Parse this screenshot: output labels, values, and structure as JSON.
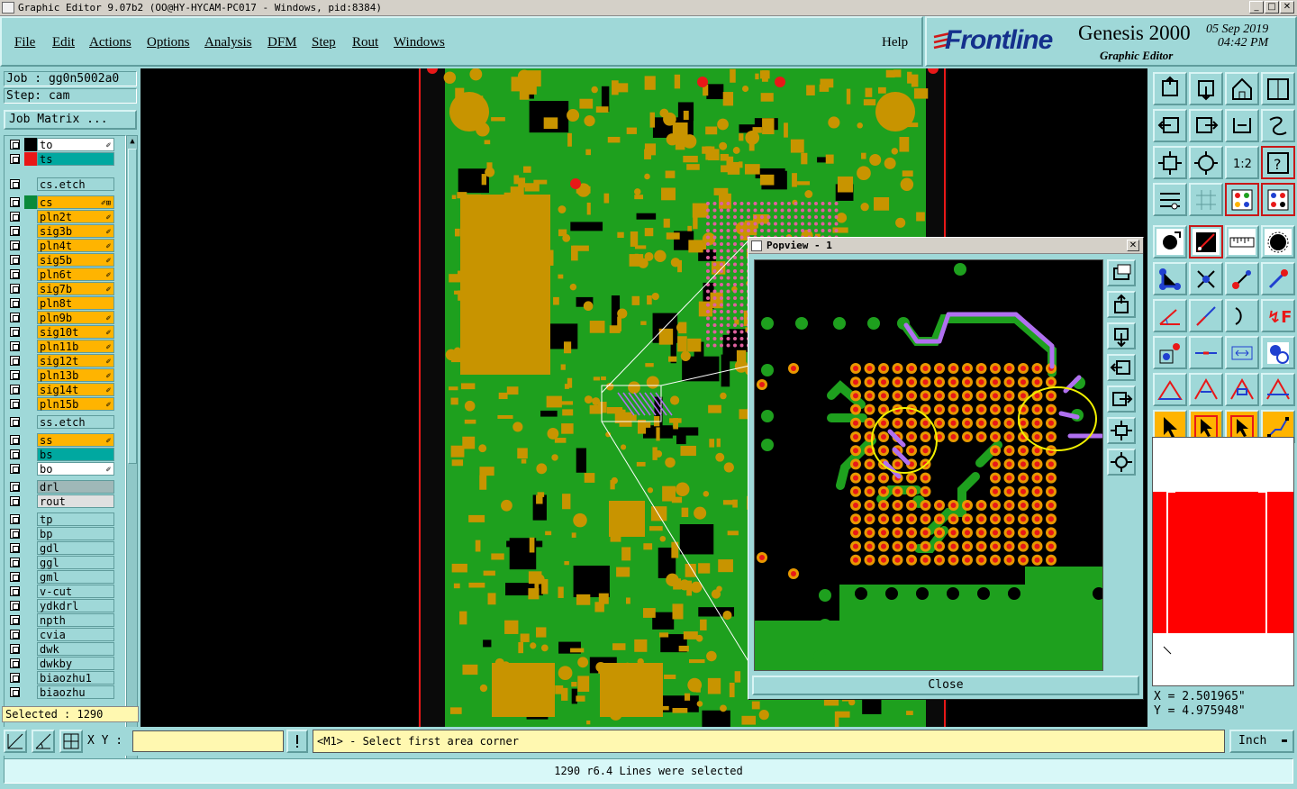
{
  "window": {
    "title": "Graphic Editor 9.07b2 (OO@HY-HYCAM-PC017 - Windows, pid:8384)"
  },
  "menu": {
    "items": [
      "File",
      "Edit",
      "Actions",
      "Options",
      "Analysis",
      "DFM",
      "Step",
      "Rout",
      "Windows"
    ],
    "help": "Help"
  },
  "brand": {
    "logo": "Frontline",
    "product": "Genesis 2000",
    "subtitle": "Graphic Editor",
    "date": "05 Sep 2019",
    "time": "04:42 PM"
  },
  "job": {
    "job_line": "Job : gg0n5002a0",
    "step_line": "Step: cam",
    "matrix_button": "Job Matrix ..."
  },
  "layers": [
    {
      "name": "to",
      "color": "#ffffff",
      "swatch": "#000000",
      "mark": "✐"
    },
    {
      "name": "ts",
      "color": "#00a8a0",
      "swatch": "#e81818",
      "mark": ""
    },
    {
      "name": "cs.etch",
      "color": "#9fd8d8",
      "swatch": "#9fd8d8",
      "mark": ""
    },
    {
      "name": "cs",
      "color": "#ffb400",
      "swatch": "#0a8a3a",
      "mark": "✐⊞"
    },
    {
      "name": "pln2t",
      "color": "#ffb400",
      "swatch": "#9fd8d8",
      "mark": "✐"
    },
    {
      "name": "sig3b",
      "color": "#ffb400",
      "swatch": "#9fd8d8",
      "mark": "✐"
    },
    {
      "name": "pln4t",
      "color": "#ffb400",
      "swatch": "#9fd8d8",
      "mark": "✐"
    },
    {
      "name": "sig5b",
      "color": "#ffb400",
      "swatch": "#9fd8d8",
      "mark": "✐"
    },
    {
      "name": "pln6t",
      "color": "#ffb400",
      "swatch": "#9fd8d8",
      "mark": "✐"
    },
    {
      "name": "sig7b",
      "color": "#ffb400",
      "swatch": "#9fd8d8",
      "mark": "✐"
    },
    {
      "name": "pln8t",
      "color": "#ffb400",
      "swatch": "#9fd8d8",
      "mark": ""
    },
    {
      "name": "pln9b",
      "color": "#ffb400",
      "swatch": "#9fd8d8",
      "mark": "✐"
    },
    {
      "name": "sig10t",
      "color": "#ffb400",
      "swatch": "#9fd8d8",
      "mark": "✐"
    },
    {
      "name": "pln11b",
      "color": "#ffb400",
      "swatch": "#9fd8d8",
      "mark": "✐"
    },
    {
      "name": "sig12t",
      "color": "#ffb400",
      "swatch": "#9fd8d8",
      "mark": "✐"
    },
    {
      "name": "pln13b",
      "color": "#ffb400",
      "swatch": "#9fd8d8",
      "mark": "✐"
    },
    {
      "name": "sig14t",
      "color": "#ffb400",
      "swatch": "#9fd8d8",
      "mark": "✐"
    },
    {
      "name": "pln15b",
      "color": "#ffb400",
      "swatch": "#9fd8d8",
      "mark": "✐"
    },
    {
      "name": "ss.etch",
      "color": "#9fd8d8",
      "swatch": "#9fd8d8",
      "mark": ""
    },
    {
      "name": "ss",
      "color": "#ffb400",
      "swatch": "#9fd8d8",
      "mark": "✐"
    },
    {
      "name": "bs",
      "color": "#00a8a0",
      "swatch": "#9fd8d8",
      "mark": ""
    },
    {
      "name": "bo",
      "color": "#ffffff",
      "swatch": "#9fd8d8",
      "mark": "✐"
    },
    {
      "name": "drl",
      "color": "#9fb8b8",
      "swatch": "#9fd8d8",
      "mark": ""
    },
    {
      "name": "rout",
      "color": "#e0e0e0",
      "swatch": "#9fd8d8",
      "mark": ""
    },
    {
      "name": "tp",
      "color": "#9fd8d8",
      "swatch": "#9fd8d8",
      "mark": ""
    },
    {
      "name": "bp",
      "color": "#9fd8d8",
      "swatch": "#9fd8d8",
      "mark": ""
    },
    {
      "name": "gdl",
      "color": "#9fd8d8",
      "swatch": "#9fd8d8",
      "mark": ""
    },
    {
      "name": "ggl",
      "color": "#9fd8d8",
      "swatch": "#9fd8d8",
      "mark": ""
    },
    {
      "name": "gml",
      "color": "#9fd8d8",
      "swatch": "#9fd8d8",
      "mark": ""
    },
    {
      "name": "v-cut",
      "color": "#9fd8d8",
      "swatch": "#9fd8d8",
      "mark": ""
    },
    {
      "name": "ydkdrl",
      "color": "#9fd8d8",
      "swatch": "#9fd8d8",
      "mark": ""
    },
    {
      "name": "npth",
      "color": "#9fd8d8",
      "swatch": "#9fd8d8",
      "mark": ""
    },
    {
      "name": "cvia",
      "color": "#9fd8d8",
      "swatch": "#9fd8d8",
      "mark": ""
    },
    {
      "name": "dwk",
      "color": "#9fd8d8",
      "swatch": "#9fd8d8",
      "mark": ""
    },
    {
      "name": "dwkby",
      "color": "#9fd8d8",
      "swatch": "#9fd8d8",
      "mark": ""
    },
    {
      "name": "biaozhu1",
      "color": "#9fd8d8",
      "swatch": "#9fd8d8",
      "mark": ""
    },
    {
      "name": "biaozhu",
      "color": "#9fd8d8",
      "swatch": "#9fd8d8",
      "mark": ""
    }
  ],
  "selection": {
    "selected_text": "Selected : 1290"
  },
  "popview": {
    "title": "Popview - 1",
    "close_label": "Close",
    "tools": [
      "zoom-home-icon",
      "pan-up-icon",
      "pan-down-icon",
      "pan-left-icon",
      "pan-right-icon",
      "zoom-fit-icon",
      "zoom-center-icon"
    ]
  },
  "tools": [
    [
      "zoom-home-icon",
      "pan-down-icon",
      "house-icon",
      "window-split-icon"
    ],
    [
      "pan-left-icon",
      "pan-right-icon",
      "undo-view-icon",
      "redo-view-icon"
    ],
    [
      "fit-all-icon",
      "zoom-center-icon",
      "scale-1-2-icon",
      "help-icon"
    ],
    [
      "layers-settings-icon",
      "grid-icon",
      "palette-icon",
      "palette-alt-icon"
    ],
    [
      "select-pad-icon",
      "measure-icon",
      "ruler-icon",
      "snap-point-icon"
    ],
    [
      "net-icon",
      "cross-icon",
      "add-segment-icon",
      "move-segment-icon"
    ],
    [
      "line-angle-icon",
      "line-icon",
      "arc-icon",
      "text-feature-icon"
    ],
    [
      "pad-icon",
      "line-horizontal-icon",
      "dimension-icon",
      "pattern-icon"
    ],
    [
      "triangle-icon",
      "triangle-a-icon",
      "triangle-b-icon",
      "triangle-c-icon"
    ],
    [
      "pointer-icon",
      "pointer-alt-icon",
      "pointer-target-icon",
      "route-icon"
    ]
  ],
  "colors": {
    "panel_bg": "#9fd8d8",
    "copper": "#1ea01e",
    "pad": "#c89400",
    "red_pad": "#e81818",
    "selected_line": "#b070f0",
    "highlight": "#f0f000"
  },
  "coords": {
    "x_line": "X = 2.501965\"",
    "y_line": "Y = 4.975948\""
  },
  "command": {
    "xy_label": "X Y :",
    "xy_value": "",
    "prompt": "<M1> - Select first area corner",
    "unit": "Inch",
    "status": "1290 r6.4 Lines were selected"
  }
}
